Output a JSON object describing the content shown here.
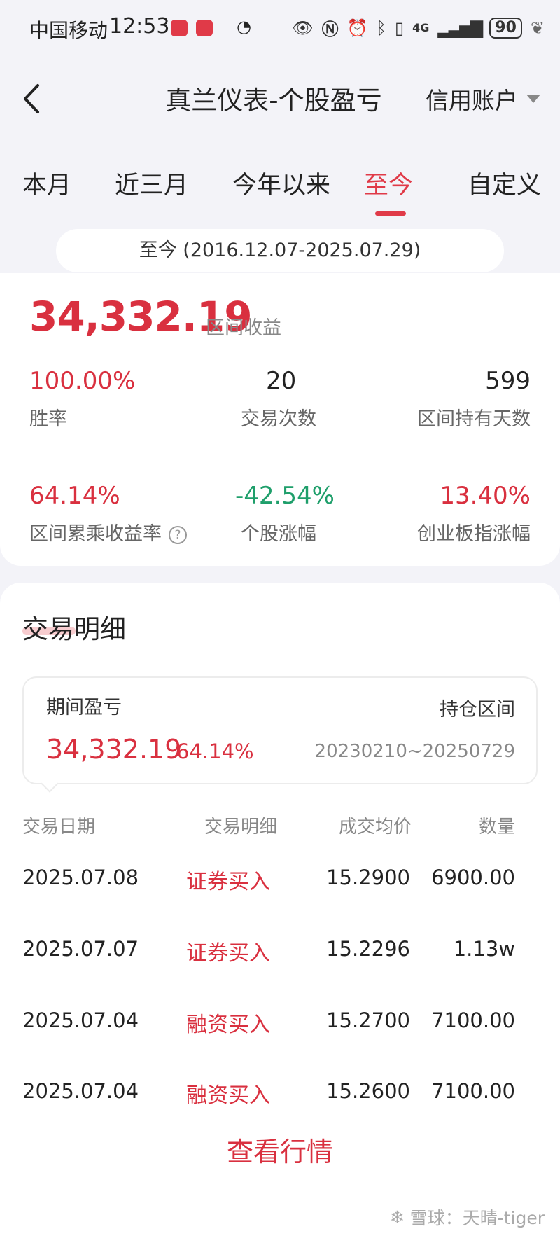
{
  "status_bar": {
    "carrier": "中国移动",
    "time": "12:53",
    "network": "4G",
    "battery": "90"
  },
  "header": {
    "title": "真兰仪表-个股盈亏",
    "account": "信用账户"
  },
  "tabs": [
    {
      "label": "本月"
    },
    {
      "label": "近三月"
    },
    {
      "label": "今年以来"
    },
    {
      "label": "至今"
    },
    {
      "label": "自定义"
    }
  ],
  "range_text": "至今 (2016.12.07-2025.07.29)",
  "summary": {
    "profit": "34,332.19",
    "profit_label": "区间收益",
    "win_rate": "100.00%",
    "win_rate_label": "胜率",
    "trade_count": "20",
    "trade_count_label": "交易次数",
    "hold_days": "599",
    "hold_days_label": "区间持有天数",
    "cum_return": "64.14%",
    "cum_return_label": "区间累乘收益率",
    "stock_change": "-42.54%",
    "stock_change_label": "个股涨幅",
    "index_change": "13.40%",
    "index_change_label": "创业板指涨幅",
    "help_glyph": "?"
  },
  "details": {
    "title": "交易明细",
    "period_label": "期间盈亏",
    "hold_label": "持仓区间",
    "period_profit": "34,332.19",
    "period_rate": "64.14%",
    "hold_range": "20230210~20250729",
    "columns": [
      "交易日期",
      "交易明细",
      "成交均价",
      "数量"
    ],
    "rows": [
      {
        "date": "2025.07.08",
        "action": "证券买入",
        "price": "15.2900",
        "qty": "6900.00"
      },
      {
        "date": "2025.07.07",
        "action": "证券买入",
        "price": "15.2296",
        "qty": "1.13w"
      },
      {
        "date": "2025.07.04",
        "action": "融资买入",
        "price": "15.2700",
        "qty": "7100.00"
      },
      {
        "date": "2025.07.04",
        "action": "融资买入",
        "price": "15.2600",
        "qty": "7100.00"
      }
    ]
  },
  "bottom": {
    "view_market": "查看行情",
    "watermark": "雪球：天晴-tiger"
  },
  "colors": {
    "accent": "#e03a48",
    "profit_red": "#d9303f",
    "loss_green": "#1f9f6b"
  }
}
